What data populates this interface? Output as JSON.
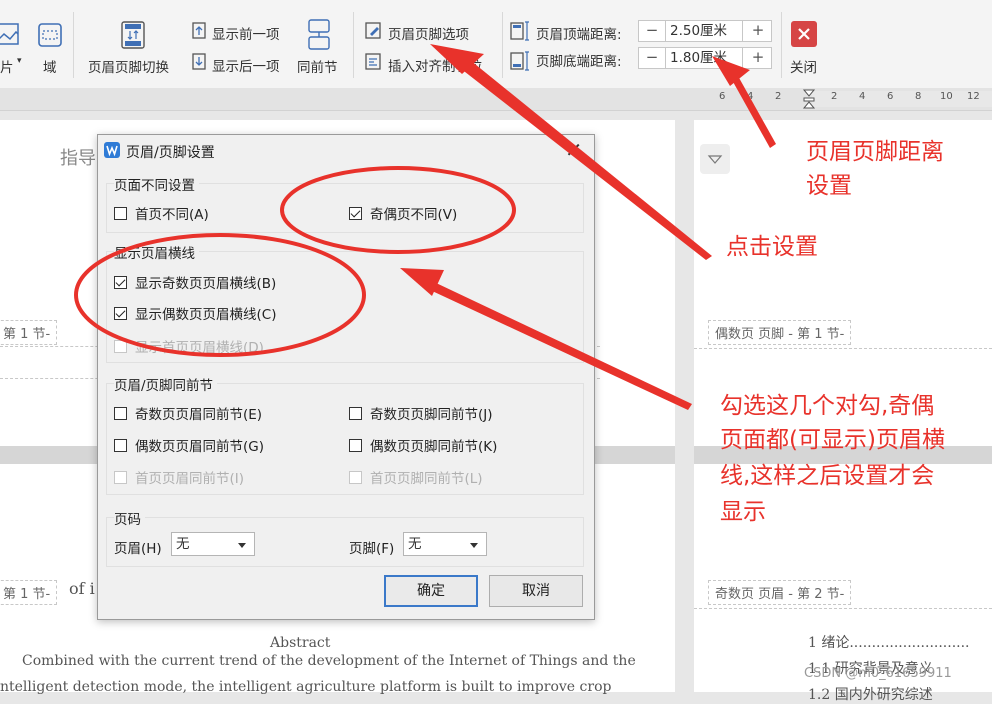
{
  "toolbar": {
    "pic_label": "片",
    "field_label": "域",
    "switch_label": "页眉页脚切换",
    "prev_label": "显示前一项",
    "next_label": "显示后一项",
    "same_prev_label": "同前节",
    "options_label": "页眉页脚选项",
    "insert_align_label": "插入对齐制表位",
    "header_top_label": "页眉顶端距离:",
    "header_top_value": "2.50厘米",
    "footer_bottom_label": "页脚底端距离:",
    "footer_bottom_value": "1.80厘米",
    "minus": "−",
    "plus": "+",
    "close_label": "关闭",
    "accent_color": "#d64545"
  },
  "ruler": {
    "numbers": [
      "6",
      "4",
      "2",
      "2",
      "4",
      "6",
      "8",
      "10",
      "12"
    ]
  },
  "document": {
    "left_header_partial": "指导",
    "section_tag_1": "第 1 节-",
    "section_tag_2": "第 1 节-",
    "of_partial": "of i",
    "abstract": "Abstract",
    "body_line_1": "Combined with the current trend of the development of the Internet of Things and the",
    "body_line_2": "ntelligent detection mode, the intelligent agriculture platform is built to improve crop",
    "right_footer_tag": "偶数页 页脚  - 第 1 节-",
    "right_header_tag": "奇数页 页眉  - 第 2 节-",
    "toc_1": "1  绪论...........................",
    "toc_2": "1.1  研究背景及意义",
    "toc_3": "1.2  国内外研究综述"
  },
  "dialog": {
    "title": "页眉/页脚设置",
    "close": "✕",
    "group_diff": "页面不同设置",
    "first_diff": "首页不同(A)",
    "odd_even_diff": "奇偶页不同(V)",
    "group_line": "显示页眉横线",
    "odd_line": "显示奇数页页眉横线(B)",
    "even_line": "显示偶数页页眉横线(C)",
    "first_line": "显示首页页眉横线(D)",
    "group_same": "页眉/页脚同前节",
    "odd_header_same": "奇数页页眉同前节(E)",
    "odd_footer_same": "奇数页页脚同前节(J)",
    "even_header_same": "偶数页页眉同前节(G)",
    "even_footer_same": "偶数页页脚同前节(K)",
    "first_header_same": "首页页眉同前节(I)",
    "first_footer_same": "首页页脚同前节(L)",
    "group_pagenum": "页码",
    "header_label": "页眉(H)",
    "header_value": "无",
    "footer_label": "页脚(F)",
    "footer_value": "无",
    "ok": "确定",
    "cancel": "取消"
  },
  "annotations": {
    "distance_1": "页眉页脚距离",
    "distance_2": "设置",
    "click_setting": "点击设置",
    "note_1": "勾选这几个对勾,奇偶",
    "note_2": "页面都(可显示)页眉横",
    "note_3": "线,这样之后设置才会",
    "note_4": "显示",
    "color": "#e8322b"
  },
  "watermark": "CSDN @m0_61659911"
}
